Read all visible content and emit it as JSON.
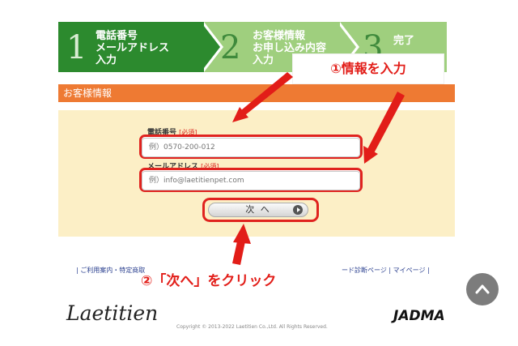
{
  "steps": [
    {
      "number": "1",
      "lines": [
        "電話番号",
        "メールアドレス",
        "入力"
      ]
    },
    {
      "number": "2",
      "lines": [
        "お客様情報",
        "お申し込み内容",
        "入力"
      ]
    },
    {
      "number": "3",
      "lines": [
        "完了"
      ]
    }
  ],
  "section_title": "お客様情報",
  "form": {
    "phone_label": "電話番号",
    "phone_required": "[必須]",
    "phone_placeholder": "例）0570-200-012",
    "email_label": "メールアドレス",
    "email_required": "[必須]",
    "email_placeholder": "例）info@laetitienpet.com",
    "next_button": "次 へ"
  },
  "annotations": {
    "callout": "①情報を入力",
    "step2": "②「次へ」をクリック"
  },
  "footer": {
    "link_left": "|  ご利用案内・特定商取",
    "link_right": "ード診断ページ  |  マイページ  |",
    "logo": "Laetitien",
    "copyright": "Copyright © 2013-2022 Laetitien Co.,Ltd. All Rights Reserved.",
    "badge": "JADMA"
  },
  "colors": {
    "step_active": "#2c8a2e",
    "step_inactive": "#9fcf7e",
    "section_header": "#ee7a33",
    "form_panel": "#fcefc6",
    "annotation_red": "#e21d18"
  },
  "icons": {
    "next": "play-circle-icon",
    "scroll_top": "chevron-up-icon"
  }
}
